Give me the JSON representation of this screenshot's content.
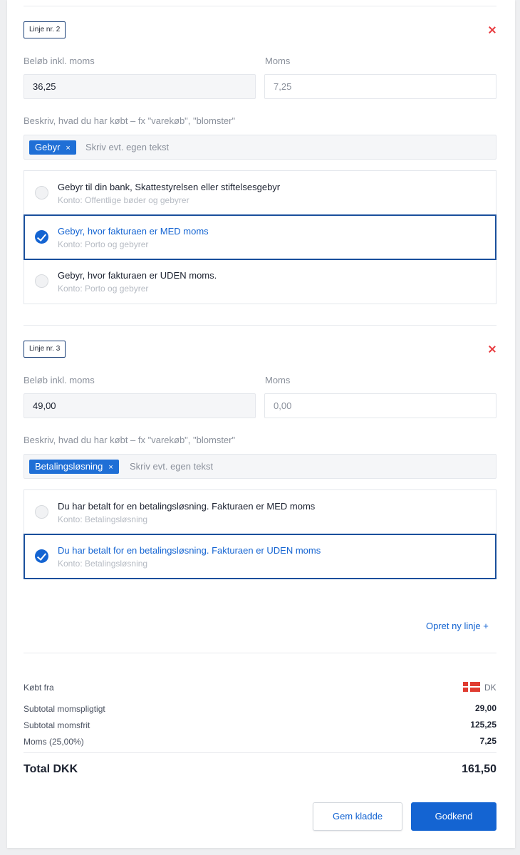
{
  "lines": [
    {
      "badge": "Linje nr. 2",
      "amount_label": "Beløb inkl. moms",
      "amount_value": "36,25",
      "vat_label": "Moms",
      "vat_value": "7,25",
      "describe_label": "Beskriv, hvad du har købt – fx \"varekøb\", \"blomster\"",
      "tag": "Gebyr",
      "tag_remove": "×",
      "tag_placeholder": "Skriv evt. egen tekst",
      "options": [
        {
          "title": "Gebyr til din bank, Skattestyrelsen eller stiftelsesgebyr",
          "account": "Konto: Offentlige bøder og gebyrer",
          "selected": false
        },
        {
          "title": "Gebyr, hvor fakturaen er MED moms",
          "account": "Konto: Porto og gebyrer",
          "selected": true
        },
        {
          "title": "Gebyr, hvor fakturaen er UDEN moms.",
          "account": "Konto: Porto og gebyrer",
          "selected": false
        }
      ]
    },
    {
      "badge": "Linje nr. 3",
      "amount_label": "Beløb inkl. moms",
      "amount_value": "49,00",
      "vat_label": "Moms",
      "vat_value": "0,00",
      "describe_label": "Beskriv, hvad du har købt – fx \"varekøb\", \"blomster\"",
      "tag": "Betalingsløsning",
      "tag_remove": "×",
      "tag_placeholder": "Skriv evt. egen tekst",
      "options": [
        {
          "title": "Du har betalt for en betalingsløsning. Fakturaen er MED moms",
          "account": "Konto: Betalingsløsning",
          "selected": false
        },
        {
          "title": "Du har betalt for en betalingsløsning. Fakturaen er UDEN moms",
          "account": "Konto: Betalingsløsning",
          "selected": true
        }
      ]
    }
  ],
  "add_line": "Opret ny linje +",
  "summary": {
    "bought_from_label": "Købt fra",
    "country_flag_icon": "denmark-flag-icon",
    "country_code": "DK",
    "subtotal_vat_label": "Subtotal momspligtigt",
    "subtotal_vat_value": "29,00",
    "subtotal_free_label": "Subtotal momsfrit",
    "subtotal_free_value": "125,25",
    "vat_label": "Moms (25,00%)",
    "vat_value": "7,25",
    "total_label": "Total DKK",
    "total_value": "161,50"
  },
  "buttons": {
    "draft": "Gem kladde",
    "approve": "Godkend"
  },
  "colors": {
    "accent": "#1464d2",
    "remove": "#e8383d"
  }
}
